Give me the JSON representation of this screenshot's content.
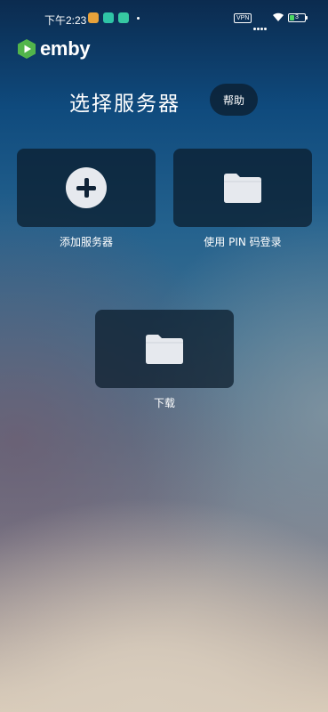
{
  "status_bar": {
    "time": "下午2:23",
    "vpn": "VPN",
    "battery_level": "3",
    "battery_fraction": 0.3
  },
  "logo": {
    "text": "emby",
    "brand_color": "#52b54b"
  },
  "header": {
    "title": "选择服务器",
    "help_label": "帮助"
  },
  "tiles": [
    {
      "label": "添加服务器",
      "icon": "plus-circle-icon"
    },
    {
      "label": "使用 PIN 码登录",
      "icon": "folder-icon"
    },
    {
      "label": "下载",
      "icon": "folder-icon"
    }
  ]
}
